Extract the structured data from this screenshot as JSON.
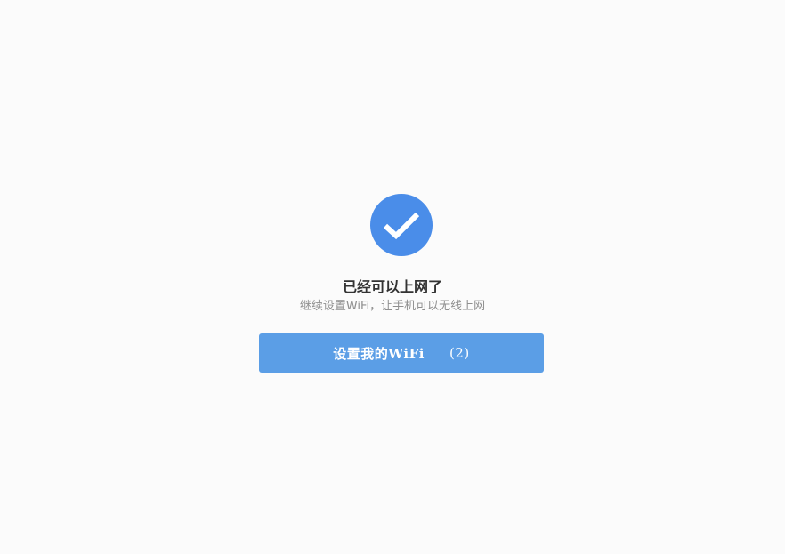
{
  "status": {
    "icon": "checkmark-circle-icon",
    "title": "已经可以上网了",
    "subtitle": "继续设置WiFi，让手机可以无线上网"
  },
  "action": {
    "button_label": "设置我的WiFi",
    "countdown": "(2)"
  },
  "colors": {
    "accent": "#4a8de9",
    "button": "#5b9ee6",
    "background": "#fbfbfb",
    "title_text": "#333333",
    "subtitle_text": "#8f8f8f"
  }
}
